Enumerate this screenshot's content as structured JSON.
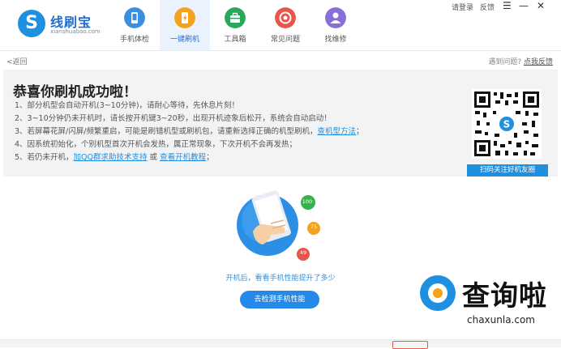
{
  "app": {
    "logo_glyph": "S",
    "name": "线刷宝",
    "subtitle": "xianshuabao.com"
  },
  "nav": {
    "items": [
      {
        "label": "手机体检",
        "icon": "phone-check-icon",
        "color": "#3b8fe0"
      },
      {
        "label": "一键刷机",
        "icon": "flash-icon",
        "color": "#f2a21b",
        "active": true
      },
      {
        "label": "工具箱",
        "icon": "toolbox-icon",
        "color": "#2aa85a"
      },
      {
        "label": "常见问题",
        "icon": "help-icon",
        "color": "#e9554b"
      },
      {
        "label": "找维修",
        "icon": "repair-icon",
        "color": "#8a6fd8"
      }
    ]
  },
  "topbar": {
    "login": "请登录",
    "feedback": "反馈",
    "menu_glyph": "☰",
    "min_glyph": "—",
    "close_glyph": "✕"
  },
  "subbar": {
    "back": "<返回",
    "problem_text": "遇到问题?",
    "problem_link": "点我反馈"
  },
  "success": {
    "title": "恭喜你刷机成功啦！",
    "steps": [
      {
        "text": "1、部分机型会自动开机(3~10分钟)，请耐心等待，先休息片刻！"
      },
      {
        "text": "2、3~10分钟仍未开机时，请长按开机键3~20秒，出现开机迹象后松开，系统会自动启动！"
      },
      {
        "text": "3、若屏幕花屏/闪屏/频繁重启，可能是刷错机型或刷机包，请重新选择正确的机型刷机，",
        "link": "查机型方法",
        "suffix": "；"
      },
      {
        "text": "4、因系统初始化，个别机型首次开机会发热，属正常现象，下次开机不会再发热；"
      },
      {
        "text": "5、若仍未开机，",
        "link": "加QQ群求助技术支持",
        "middle": " 或 ",
        "link2": "查看开机教程",
        "suffix": "；"
      }
    ],
    "qr_button": "扫码关注好机友圈"
  },
  "center": {
    "badges": [
      "100",
      "75",
      "49"
    ],
    "tip": "开机后，看看手机性能提升了多少",
    "button": "去检测手机性能"
  },
  "watermark": {
    "cn": "查询啦",
    "en": "chaxunla.com"
  },
  "colors": {
    "accent": "#1f8fe0",
    "panel_bg": "#f2f3f5",
    "button": "#2489e8"
  }
}
